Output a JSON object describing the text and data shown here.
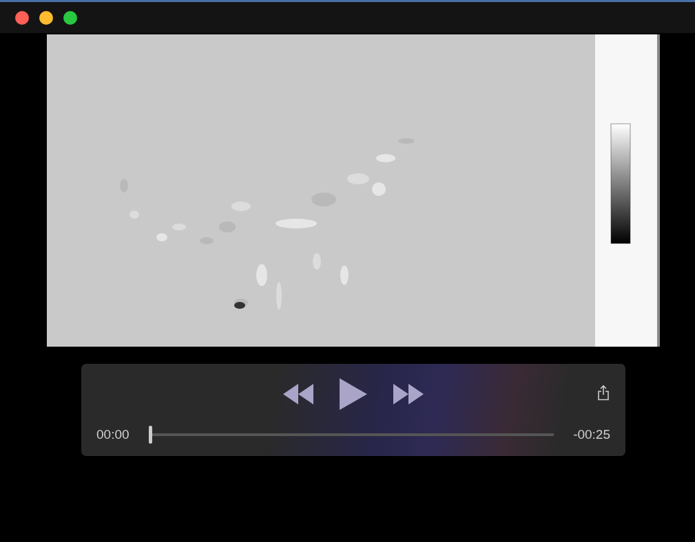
{
  "controls": {
    "playing": false,
    "elapsed": "00:00",
    "remaining": "-00:25",
    "progress": {
      "level": 0
    }
  }
}
